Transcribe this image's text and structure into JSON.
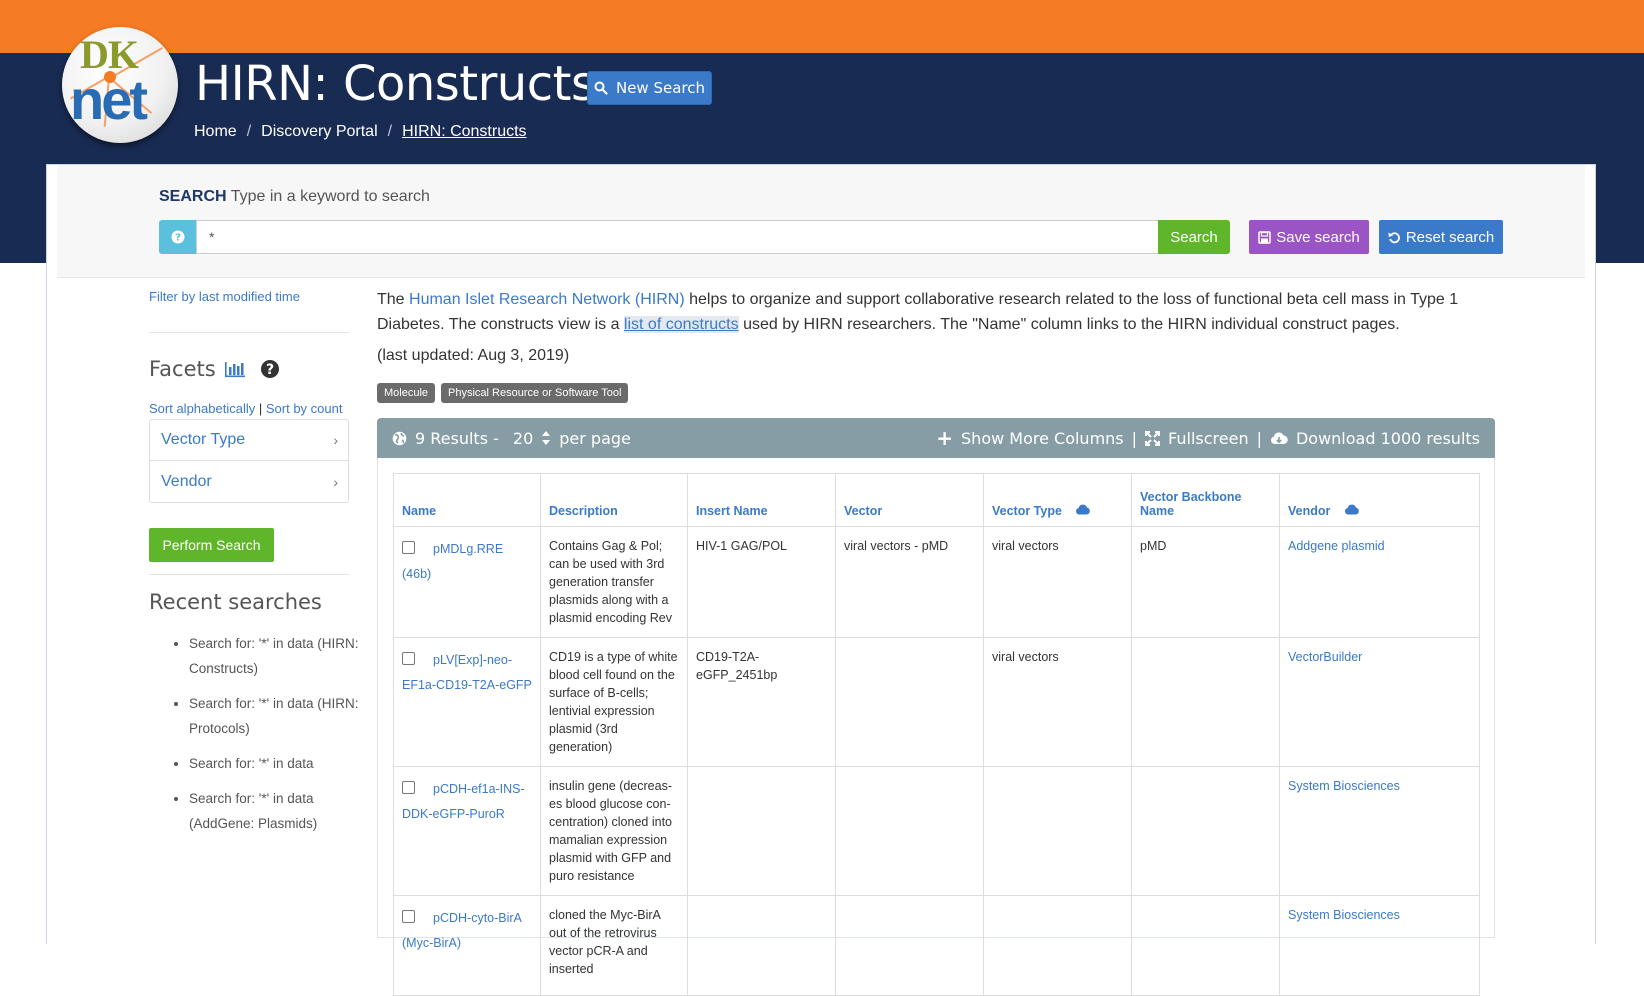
{
  "header": {
    "logo_top": "DK",
    "logo_bottom": "net",
    "title": "HIRN: Constructs",
    "new_search_label": "New Search",
    "breadcrumb": [
      "Home",
      "/",
      "Discovery Portal",
      "/",
      "HIRN: Constructs"
    ]
  },
  "search": {
    "label_bold": "SEARCH",
    "label_rest": "Type in a keyword to search",
    "value": "*",
    "search_label": "Search",
    "save_label": "Save search",
    "reset_label": "Reset search"
  },
  "sidebar": {
    "filter_link": "Filter by last modified time",
    "facets_title": "Facets",
    "sort_alpha": "Sort alphabetically",
    "sort_sep": "|",
    "sort_count": "Sort by count",
    "facets": [
      "Vector Type",
      "Vendor"
    ],
    "perform_label": "Perform Search",
    "recent_title": "Recent searches",
    "recent": [
      "Search for: '*' in data (HIRN: Constructs)",
      "Search for: '*' in data (HIRN: Protocols)",
      "Search for: '*' in data",
      "Search for: '*' in data (AddGene: Plasmids)"
    ]
  },
  "content": {
    "intro_1": "The ",
    "intro_link": "Human Islet Research Network (HIRN)",
    "intro_2": " helps to organize and support collaborative research related to the loss of functional beta cell mass in Type 1 Diabetes. The constructs view is a ",
    "intro_highlight": "list of constructs",
    "intro_3": " used by HIRN researchers. The \"Name\" column links to the HIRN individual construct pages.",
    "updated": "(last updated: Aug 3, 2019)",
    "tags": [
      "Molecule",
      "Physical Resource or Software Tool"
    ]
  },
  "results": {
    "count_text": "9 Results -",
    "per_page_value": "20",
    "per_page_label": "per page",
    "show_more": "Show More Columns",
    "sep": "|",
    "fullscreen": "Fullscreen",
    "download": "Download 1000 results",
    "columns": [
      "Name",
      "Description",
      "Insert Name",
      "Vector",
      "Vector Type",
      "Vector Backbone Name",
      "Vendor"
    ],
    "rows": [
      {
        "name": "pMDLg.RRE (46b)",
        "description": "Contains Gag & Pol; can be used with 3rd generation transfer plasmids along with a plasmid encoding Rev",
        "insert_name": "HIV-1 GAG/POL",
        "vector": "viral vectors - pMD",
        "vector_type": "viral vectors",
        "backbone": "pMD",
        "vendor": "Addgene plasmid"
      },
      {
        "name": "pLV[Exp]-neo-EF1a-CD19-T2A-eGFP",
        "description": "CD19 is a type of white blood cell found on the surface of B-cells; lentivial expression plasmid (3rd generation)",
        "insert_name": "CD19-T2A-eGFP_2451bp",
        "vector": "",
        "vector_type": "viral vectors",
        "backbone": "",
        "vendor": "VectorBuilder"
      },
      {
        "name": "pCDH-ef1a-INS-DDK-eGFP-PuroR",
        "description": "insulin gene (decreas-es blood glucose con-centration) cloned into mamalian expression plasmid with GFP and puro resistance",
        "insert_name": "",
        "vector": "",
        "vector_type": "",
        "backbone": "",
        "vendor": "System Biosciences"
      },
      {
        "name": "pCDH-cyto-BirA (Myc-BirA)",
        "description": "cloned the Myc-BirA out of the retrovirus vector pCR-A and inserted",
        "insert_name": "",
        "vector": "",
        "vector_type": "",
        "backbone": "",
        "vendor": "System Biosciences"
      }
    ]
  },
  "colors": {
    "orange": "#f57c25",
    "navy": "#182b53",
    "link": "#3a7ac8",
    "green": "#5fb62a",
    "purple": "#9b54c4",
    "results_bar": "#879da6"
  },
  "icons": {
    "new_search": "search-icon",
    "help": "question-icon",
    "save": "floppy-icon",
    "reset": "undo-icon",
    "facets": "bar-chart-icon",
    "facets_help": "question-circle-icon",
    "results": "globe-icon",
    "per_page": "sort-icon",
    "show_more": "plus-icon",
    "fullscreen": "expand-icon",
    "download": "cloud-download-icon",
    "column_download": "cloud-icon"
  }
}
